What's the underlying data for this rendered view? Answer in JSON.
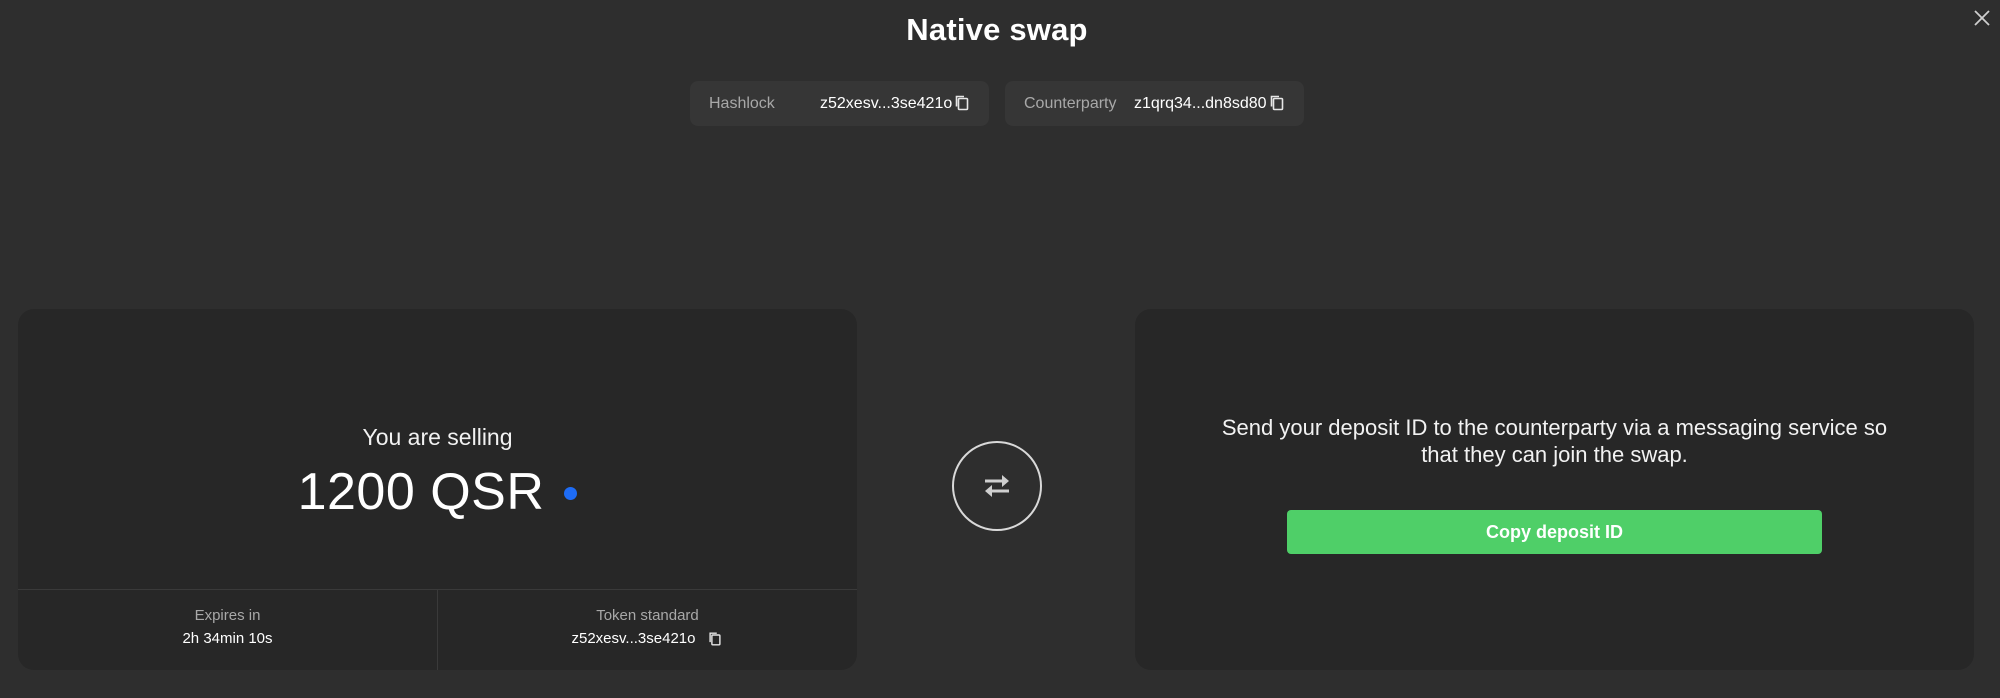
{
  "dialog": {
    "title": "Native swap"
  },
  "header": {
    "hashlock": {
      "label": "Hashlock",
      "value": "z52xesv...3se421o",
      "copy_icon": "copy-icon"
    },
    "counterparty": {
      "label": "Counterparty",
      "value": "z1qrq34...dn8sd80",
      "copy_icon": "copy-icon"
    }
  },
  "selling_card": {
    "label": "You are selling",
    "amount": "1200 QSR",
    "token_dot_color": "#1e6cf5",
    "expires": {
      "label": "Expires in",
      "value": "2h 34min 10s"
    },
    "token_standard": {
      "label": "Token standard",
      "value": "z52xesv...3se421o"
    }
  },
  "swap_icon": "swap-arrows-icon",
  "deposit_card": {
    "instruction": "Send your deposit ID to the counterparty via a messaging service so that they can join the swap.",
    "button_label": "Copy deposit ID",
    "button_color": "#4fcf68"
  },
  "icons": {
    "close": "close-icon"
  }
}
